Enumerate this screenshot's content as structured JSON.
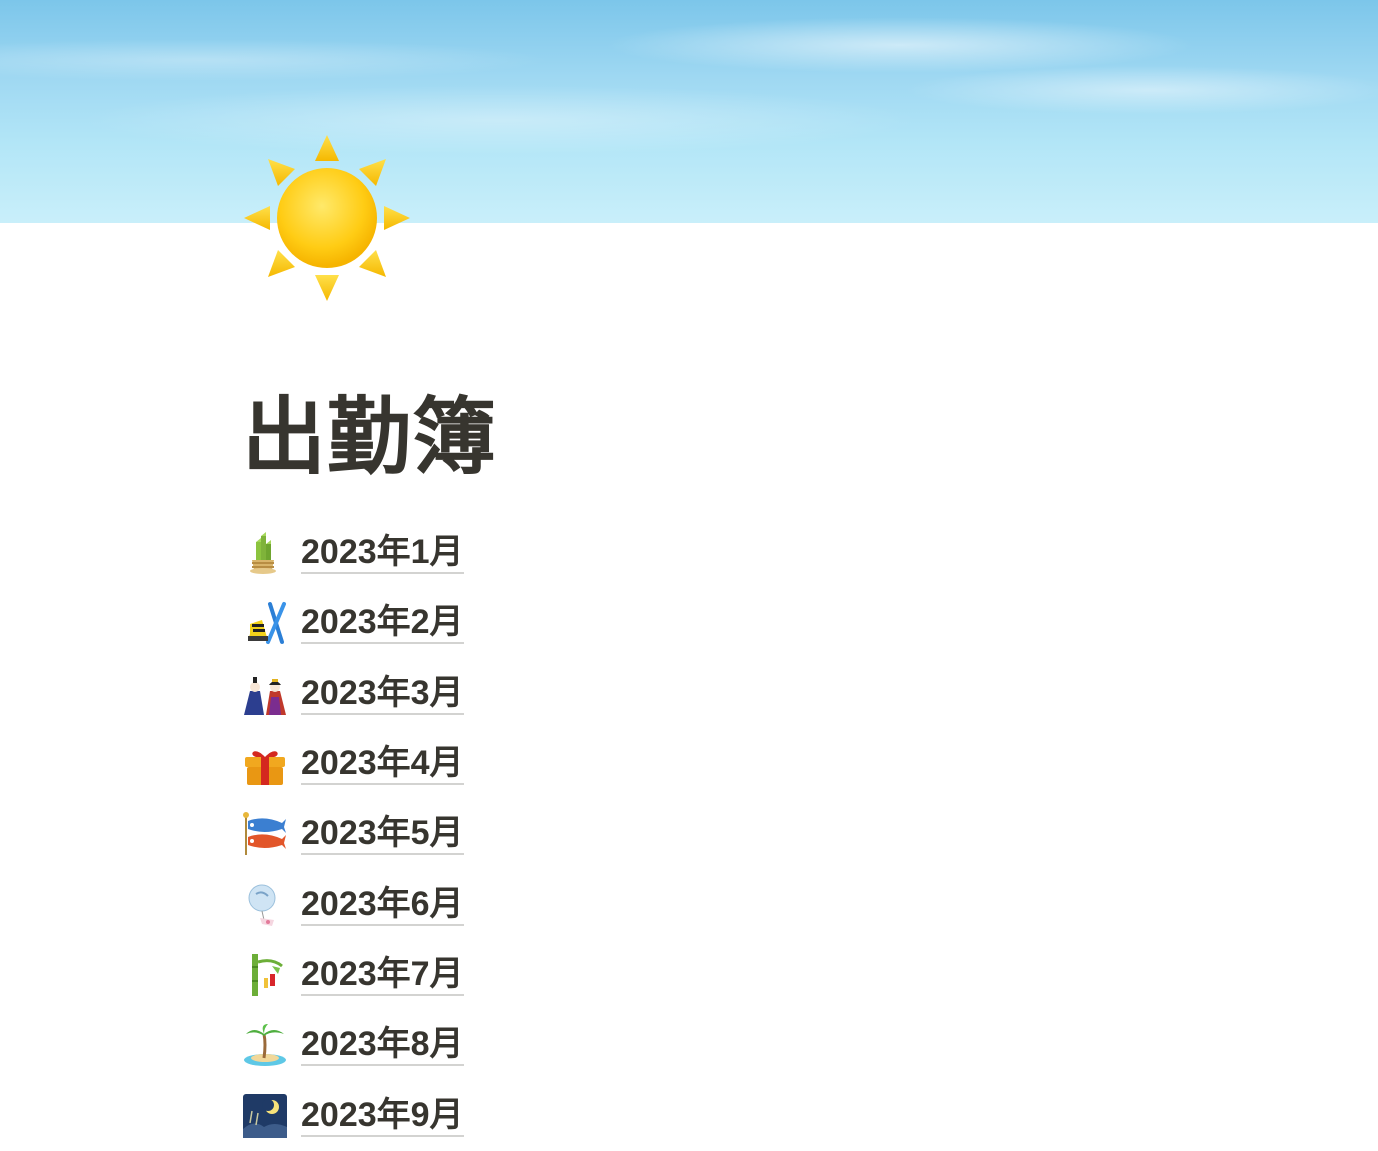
{
  "page": {
    "title": "出勤簿",
    "icon": "sun-icon"
  },
  "cover": {
    "description_colors": [
      "#7cc6ea",
      "#c9effa"
    ]
  },
  "links": [
    {
      "label": "2023年1月",
      "icon": "kadomatsu-icon"
    },
    {
      "label": "2023年2月",
      "icon": "ski-icon"
    },
    {
      "label": "2023年3月",
      "icon": "dolls-icon"
    },
    {
      "label": "2023年4月",
      "icon": "gift-icon"
    },
    {
      "label": "2023年5月",
      "icon": "carp-streamer-icon"
    },
    {
      "label": "2023年6月",
      "icon": "wind-chime-icon"
    },
    {
      "label": "2023年7月",
      "icon": "tanabata-tree-icon"
    },
    {
      "label": "2023年8月",
      "icon": "island-icon"
    },
    {
      "label": "2023年9月",
      "icon": "moon-viewing-icon"
    }
  ]
}
